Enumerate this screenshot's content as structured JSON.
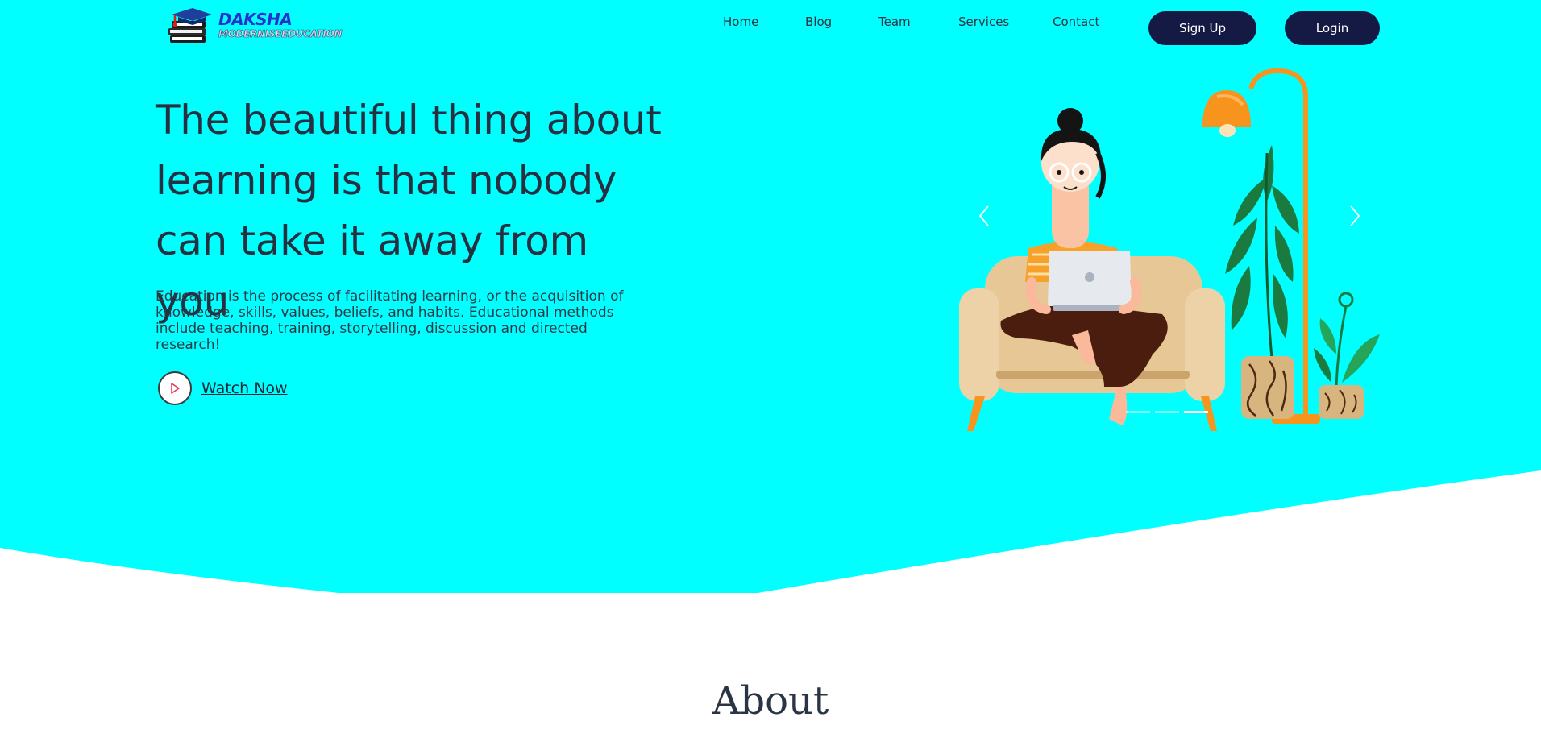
{
  "brand": {
    "name": "DAKSHA",
    "tagline": "MODERNISEEDUCATION"
  },
  "nav": {
    "items": [
      "Home",
      "Blog",
      "Team",
      "Services",
      "Contact"
    ]
  },
  "actions": {
    "signup": "Sign Up",
    "login": "Login"
  },
  "hero": {
    "headline": "The beautiful thing about learning is that nobody can take it away from you",
    "description": "Education is the process of facilitating learning, or the acquisition of knowledge, skills, values, beliefs, and habits. Educational methods include teaching, training, storytelling, discussion and directed research!",
    "watch_label": "Watch Now"
  },
  "carousel": {
    "slide_count": 3,
    "active_slide": 3
  },
  "about": {
    "title": "About"
  },
  "colors": {
    "hero_bg": "#00ffff",
    "button_bg": "#151a44",
    "text_dark": "#263040",
    "accent_orange": "#f7941d"
  },
  "icons": [
    "logo-books-cap",
    "play-icon",
    "chevron-left-icon",
    "chevron-right-icon"
  ]
}
